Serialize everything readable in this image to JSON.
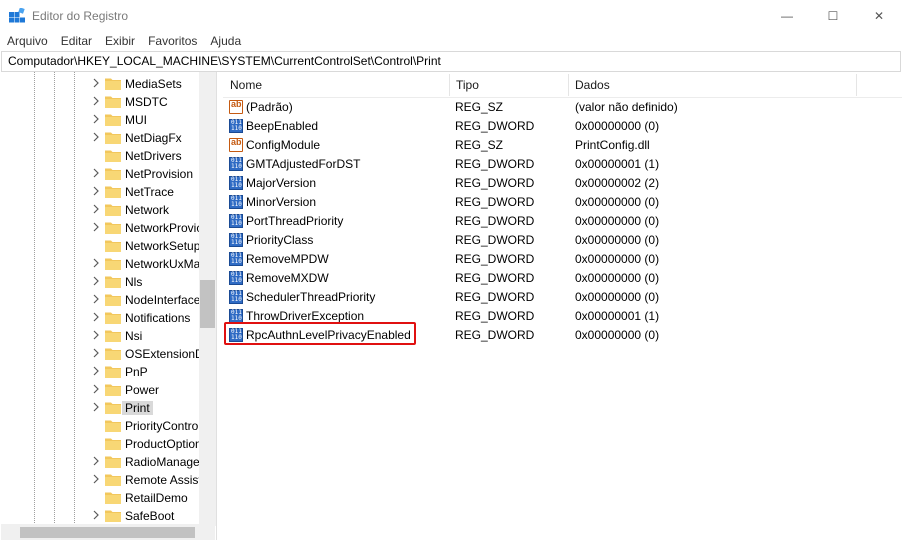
{
  "window": {
    "title": "Editor do Registro",
    "minimize_glyph": "—",
    "maximize_glyph": "☐",
    "close_glyph": "✕"
  },
  "menu": [
    "Arquivo",
    "Editar",
    "Exibir",
    "Favoritos",
    "Ajuda"
  ],
  "address": "Computador\\HKEY_LOCAL_MACHINE\\SYSTEM\\CurrentControlSet\\Control\\Print",
  "tree": {
    "items": [
      {
        "label": "MediaSets",
        "expandable": true
      },
      {
        "label": "MSDTC",
        "expandable": true
      },
      {
        "label": "MUI",
        "expandable": true
      },
      {
        "label": "NetDiagFx",
        "expandable": true
      },
      {
        "label": "NetDrivers",
        "expandable": false
      },
      {
        "label": "NetProvision",
        "expandable": true
      },
      {
        "label": "NetTrace",
        "expandable": true
      },
      {
        "label": "Network",
        "expandable": true
      },
      {
        "label": "NetworkProvic",
        "expandable": true
      },
      {
        "label": "NetworkSetup",
        "expandable": false
      },
      {
        "label": "NetworkUxMa",
        "expandable": true
      },
      {
        "label": "Nls",
        "expandable": true
      },
      {
        "label": "NodeInterface",
        "expandable": true
      },
      {
        "label": "Notifications",
        "expandable": true
      },
      {
        "label": "Nsi",
        "expandable": true
      },
      {
        "label": "OSExtensionD",
        "expandable": true
      },
      {
        "label": "PnP",
        "expandable": true
      },
      {
        "label": "Power",
        "expandable": true
      },
      {
        "label": "Print",
        "expandable": true,
        "selected": true
      },
      {
        "label": "PriorityContro",
        "expandable": false
      },
      {
        "label": "ProductOption",
        "expandable": false
      },
      {
        "label": "RadioManager",
        "expandable": true
      },
      {
        "label": "Remote Assist",
        "expandable": true
      },
      {
        "label": "RetailDemo",
        "expandable": false
      },
      {
        "label": "SafeBoot",
        "expandable": true
      }
    ]
  },
  "columns": {
    "name": "Nome",
    "type": "Tipo",
    "data": "Dados"
  },
  "values": [
    {
      "name": "(Padrão)",
      "type": "REG_SZ",
      "data": "(valor não definido)",
      "icon": "string-value-icon"
    },
    {
      "name": "BeepEnabled",
      "type": "REG_DWORD",
      "data": "0x00000000 (0)",
      "icon": "binary-value-icon"
    },
    {
      "name": "ConfigModule",
      "type": "REG_SZ",
      "data": "PrintConfig.dll",
      "icon": "string-value-icon"
    },
    {
      "name": "GMTAdjustedForDST",
      "type": "REG_DWORD",
      "data": "0x00000001 (1)",
      "icon": "binary-value-icon"
    },
    {
      "name": "MajorVersion",
      "type": "REG_DWORD",
      "data": "0x00000002 (2)",
      "icon": "binary-value-icon"
    },
    {
      "name": "MinorVersion",
      "type": "REG_DWORD",
      "data": "0x00000000 (0)",
      "icon": "binary-value-icon"
    },
    {
      "name": "PortThreadPriority",
      "type": "REG_DWORD",
      "data": "0x00000000 (0)",
      "icon": "binary-value-icon"
    },
    {
      "name": "PriorityClass",
      "type": "REG_DWORD",
      "data": "0x00000000 (0)",
      "icon": "binary-value-icon"
    },
    {
      "name": "RemoveMPDW",
      "type": "REG_DWORD",
      "data": "0x00000000 (0)",
      "icon": "binary-value-icon"
    },
    {
      "name": "RemoveMXDW",
      "type": "REG_DWORD",
      "data": "0x00000000 (0)",
      "icon": "binary-value-icon"
    },
    {
      "name": "SchedulerThreadPriority",
      "type": "REG_DWORD",
      "data": "0x00000000 (0)",
      "icon": "binary-value-icon"
    },
    {
      "name": "ThrowDriverException",
      "type": "REG_DWORD",
      "data": "0x00000001 (1)",
      "icon": "binary-value-icon"
    },
    {
      "name": "RpcAuthnLevelPrivacyEnabled",
      "type": "REG_DWORD",
      "data": "0x00000000 (0)",
      "icon": "binary-value-icon",
      "highlighted": true
    }
  ],
  "colors": {
    "highlight": "#e01010",
    "selection": "#d9d9d9",
    "folder": "#f2c75c"
  }
}
